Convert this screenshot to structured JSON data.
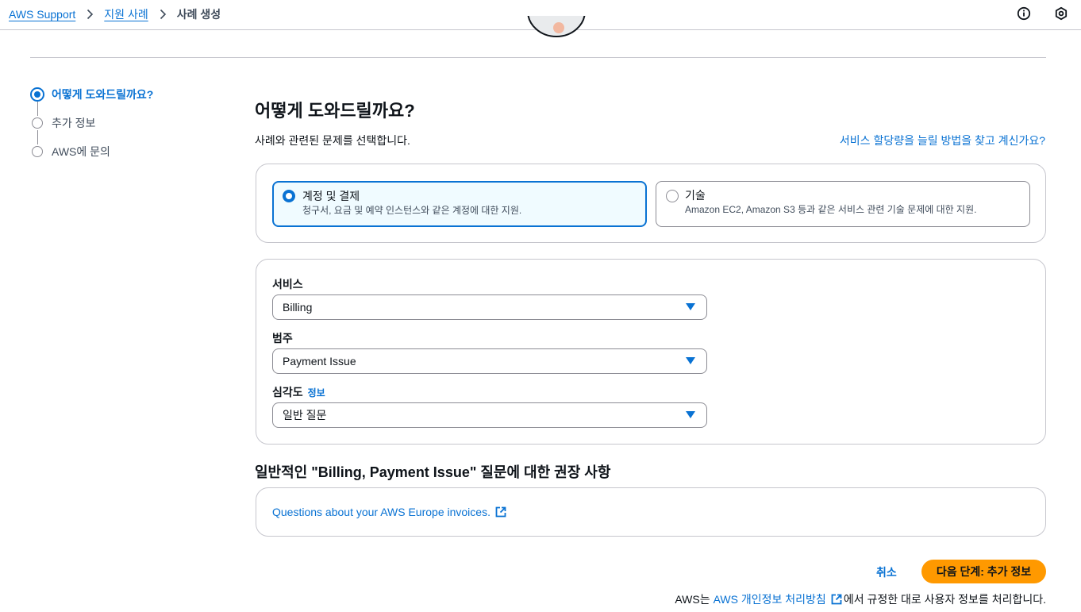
{
  "breadcrumb": {
    "items": [
      "AWS Support",
      "지원 사례"
    ],
    "current": "사례 생성"
  },
  "steps": [
    {
      "label": "어떻게 도와드릴까요?",
      "active": true
    },
    {
      "label": "추가 정보",
      "active": false
    },
    {
      "label": "AWS에 문의",
      "active": false
    }
  ],
  "main": {
    "title": "어떻게 도와드릴까요?",
    "subtitle": "사례와 관련된 문제를 선택합니다.",
    "quota_link": "서비스 할당량을 늘릴 방법을 찾고 계신가요?"
  },
  "case_types": [
    {
      "title": "계정 및 결제",
      "description": "청구서, 요금 및 예약 인스턴스와 같은 계정에 대한 지원.",
      "selected": true
    },
    {
      "title": "기술",
      "description": "Amazon EC2, Amazon S3 등과 같은 서비스 관련 기술 문제에 대한 지원.",
      "selected": false
    }
  ],
  "form": {
    "service_label": "서비스",
    "service_value": "Billing",
    "category_label": "범주",
    "category_value": "Payment Issue",
    "severity_label": "심각도",
    "severity_info": "정보",
    "severity_value": "일반 질문"
  },
  "recommendations": {
    "heading": "일반적인 \"Billing, Payment Issue\" 질문에 대한 권장 사항",
    "links": [
      "Questions about your AWS Europe invoices."
    ]
  },
  "actions": {
    "cancel": "취소",
    "next": "다음 단계: 추가 정보"
  },
  "privacy": {
    "prefix": "AWS는",
    "link": "AWS 개인정보 처리방침",
    "suffix": "에서 규정한 대로 사용자 정보를 처리합니다."
  },
  "colors": {
    "accent": "#0972d3",
    "primary_button": "#ff9900",
    "selected_card_bg": "#f0fbff"
  },
  "icons": [
    "chevron-right-icon",
    "info-circle-icon",
    "settings-icon",
    "external-link-icon"
  ]
}
